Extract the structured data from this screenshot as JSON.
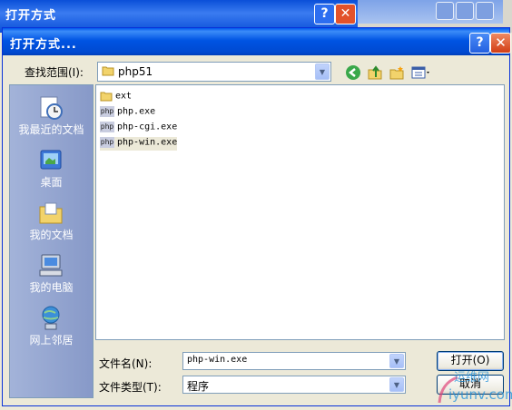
{
  "background_window": {
    "title": "打开方式"
  },
  "dialog": {
    "title": "打开方式...",
    "help_label": "?",
    "close_label": "✕",
    "look_in": {
      "label": "查找范围(I):",
      "value": "php51"
    },
    "places": [
      {
        "label": "我最近的文档",
        "icon": "recent-documents-icon"
      },
      {
        "label": "桌面",
        "icon": "desktop-icon"
      },
      {
        "label": "我的文档",
        "icon": "my-documents-icon"
      },
      {
        "label": "我的电脑",
        "icon": "my-computer-icon"
      },
      {
        "label": "网上邻居",
        "icon": "network-places-icon"
      }
    ],
    "files": [
      {
        "name": "ext",
        "type": "folder"
      },
      {
        "name": "php.exe",
        "type": "exe"
      },
      {
        "name": "php-cgi.exe",
        "type": "exe"
      },
      {
        "name": "php-win.exe",
        "type": "exe",
        "selected": true
      }
    ],
    "exe_icon_text": "php",
    "file_name": {
      "label": "文件名(N):",
      "value": "php-win.exe"
    },
    "file_type": {
      "label": "文件类型(T):",
      "value": "程序"
    },
    "open_label": "打开(O)",
    "cancel_label": "取消"
  },
  "watermark": {
    "text_top": "运维网",
    "text_bottom": "iyunv.com"
  },
  "colors": {
    "titlebar": "#0054e3",
    "close": "#d23d14",
    "face": "#ece9d8",
    "places": "#8799c8"
  }
}
